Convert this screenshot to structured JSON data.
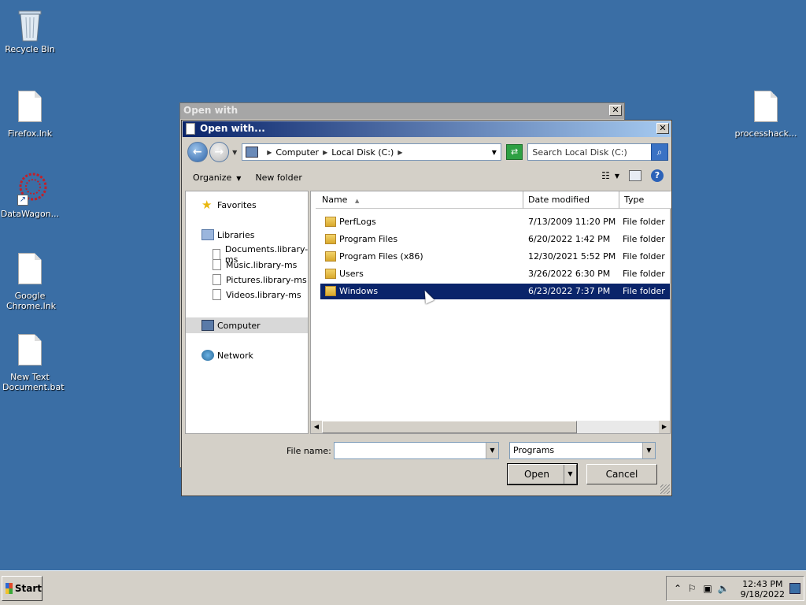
{
  "desktop": {
    "icons": [
      {
        "label": "Recycle Bin"
      },
      {
        "label": "Firefox.lnk"
      },
      {
        "label": "DataWagon..."
      },
      {
        "label": "Google Chrome.lnk"
      },
      {
        "label": "New Text Document.bat"
      },
      {
        "label": "processhack..."
      }
    ]
  },
  "back_window": {
    "title": "Open with",
    "close": "✕"
  },
  "dialog": {
    "title": "Open with...",
    "close": "✕",
    "address": {
      "crumbs": [
        "Computer",
        "Local Disk (C:)"
      ]
    },
    "search_placeholder": "Search Local Disk (C:)",
    "toolbar": {
      "organize": "Organize",
      "new_folder": "New folder",
      "help": "?"
    },
    "nav": {
      "favorites": "Favorites",
      "libraries": "Libraries",
      "library_items": [
        "Documents.library-ms",
        "Music.library-ms",
        "Pictures.library-ms",
        "Videos.library-ms"
      ],
      "computer": "Computer",
      "network": "Network"
    },
    "columns": {
      "name": "Name",
      "date": "Date modified",
      "type": "Type"
    },
    "files": [
      {
        "name": "PerfLogs",
        "date": "7/13/2009 11:20 PM",
        "type": "File folder"
      },
      {
        "name": "Program Files",
        "date": "6/20/2022 1:42 PM",
        "type": "File folder"
      },
      {
        "name": "Program Files (x86)",
        "date": "12/30/2021 5:52 PM",
        "type": "File folder"
      },
      {
        "name": "Users",
        "date": "3/26/2022 6:30 PM",
        "type": "File folder"
      },
      {
        "name": "Windows",
        "date": "6/23/2022 7:37 PM",
        "type": "File folder"
      }
    ],
    "selected_file": "Windows",
    "file_name_label": "File name:",
    "file_name_value": "",
    "filter": "Programs",
    "open_label": "Open",
    "cancel_label": "Cancel"
  },
  "taskbar": {
    "start_label": "Start",
    "time": "12:43 PM",
    "date": "9/18/2022"
  }
}
